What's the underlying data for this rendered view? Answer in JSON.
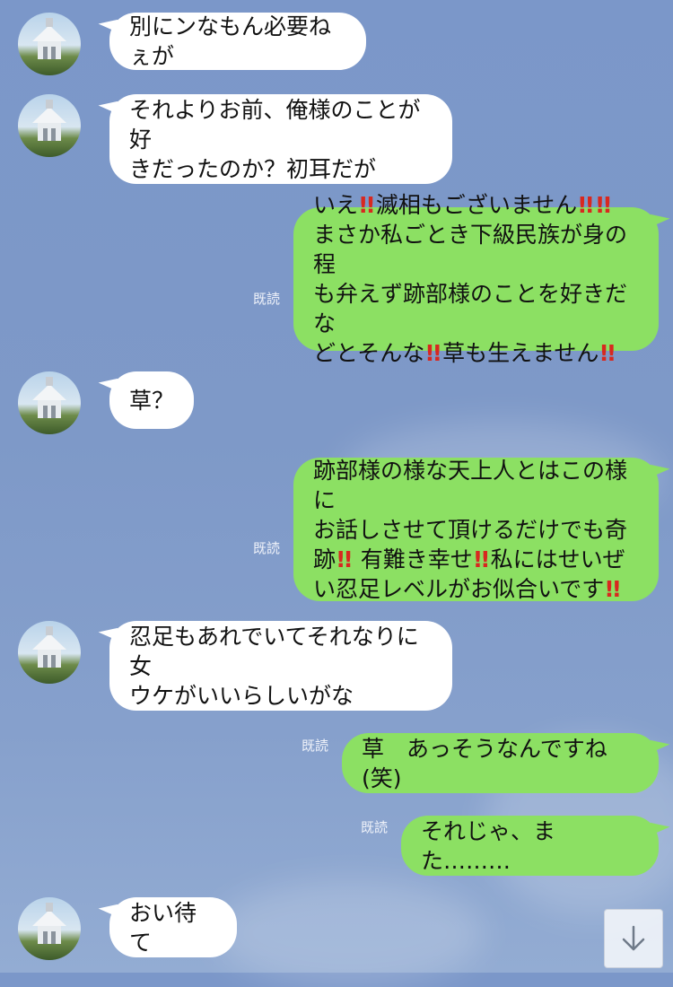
{
  "messages": [
    {
      "side": "in",
      "text": "別にンなもん必要ねぇが"
    },
    {
      "side": "in",
      "text": "それよりお前、俺様のことが好\nきだったのか？初耳だが"
    },
    {
      "side": "out",
      "read": "既読",
      "parts": [
        "いえ",
        "!!",
        "滅相もございません",
        "!!",
        "!!",
        "\nまさか私ごとき下級民族が身の程\nも弁えず跡部様のことを好きだな\nどとそんな",
        "!!",
        "草も生えません",
        "!!"
      ]
    },
    {
      "side": "in",
      "text": "草？"
    },
    {
      "side": "out",
      "read": "既読",
      "parts": [
        "跡部様の様な天上人とはこの様に\nお話しさせて頂けるだけでも奇\n跡",
        "!!",
        " 有難き幸せ",
        "!!",
        "私にはせいぜ\nい忍足レベルがお似合いです",
        "!!"
      ]
    },
    {
      "side": "in",
      "text": "忍足もあれでいてそれなりに女\nウケがいいらしいがな"
    },
    {
      "side": "out",
      "read": "既読",
      "text": "草　あっそうなんですね(笑)"
    },
    {
      "side": "out",
      "read": "既読",
      "text": "それじゃ、また………"
    },
    {
      "side": "in",
      "text": "おい待て"
    }
  ],
  "scroll_button": {
    "icon": "arrow-down-icon"
  },
  "colors": {
    "incoming": "#ffffff",
    "outgoing": "#8ce063",
    "background": "#7e99c8",
    "exclamation": "#d8281f"
  }
}
